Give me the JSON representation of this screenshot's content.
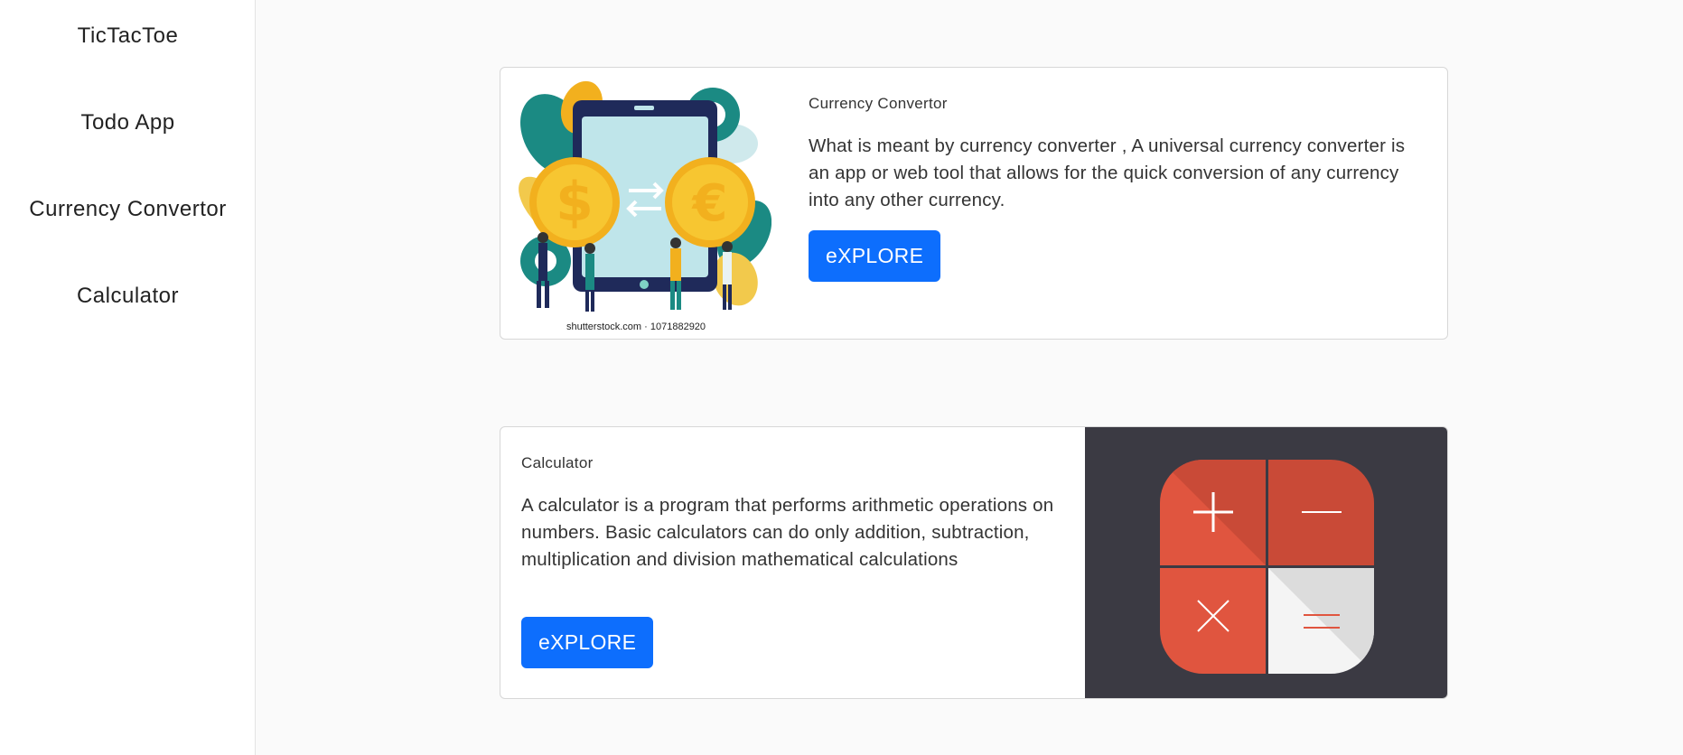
{
  "sidebar": {
    "items": [
      {
        "label": "TicTacToe"
      },
      {
        "label": "Todo App"
      },
      {
        "label": "Currency Convertor"
      },
      {
        "label": "Calculator"
      }
    ]
  },
  "cards": [
    {
      "title": "Currency Convertor",
      "description": "What is meant by currency converter , A universal currency converter is an app or web tool that allows for the quick conversion of any currency into any other currency.",
      "button_label": "eXPLORE",
      "image_watermark": "shutterstock.com · 1071882920",
      "image_icon": "currency-exchange-illustration"
    },
    {
      "title": "Calculator",
      "description": "A calculator is a program that performs arithmetic operations on numbers. Basic calculators can do only addition, subtraction, multiplication and division mathematical calculations",
      "button_label": "eXPLORE",
      "image_icon": "calculator-app-icon"
    }
  ],
  "colors": {
    "primary_button": "#0d6efd",
    "calculator_bg": "#3b3a43",
    "calculator_red": "#e0553f"
  }
}
